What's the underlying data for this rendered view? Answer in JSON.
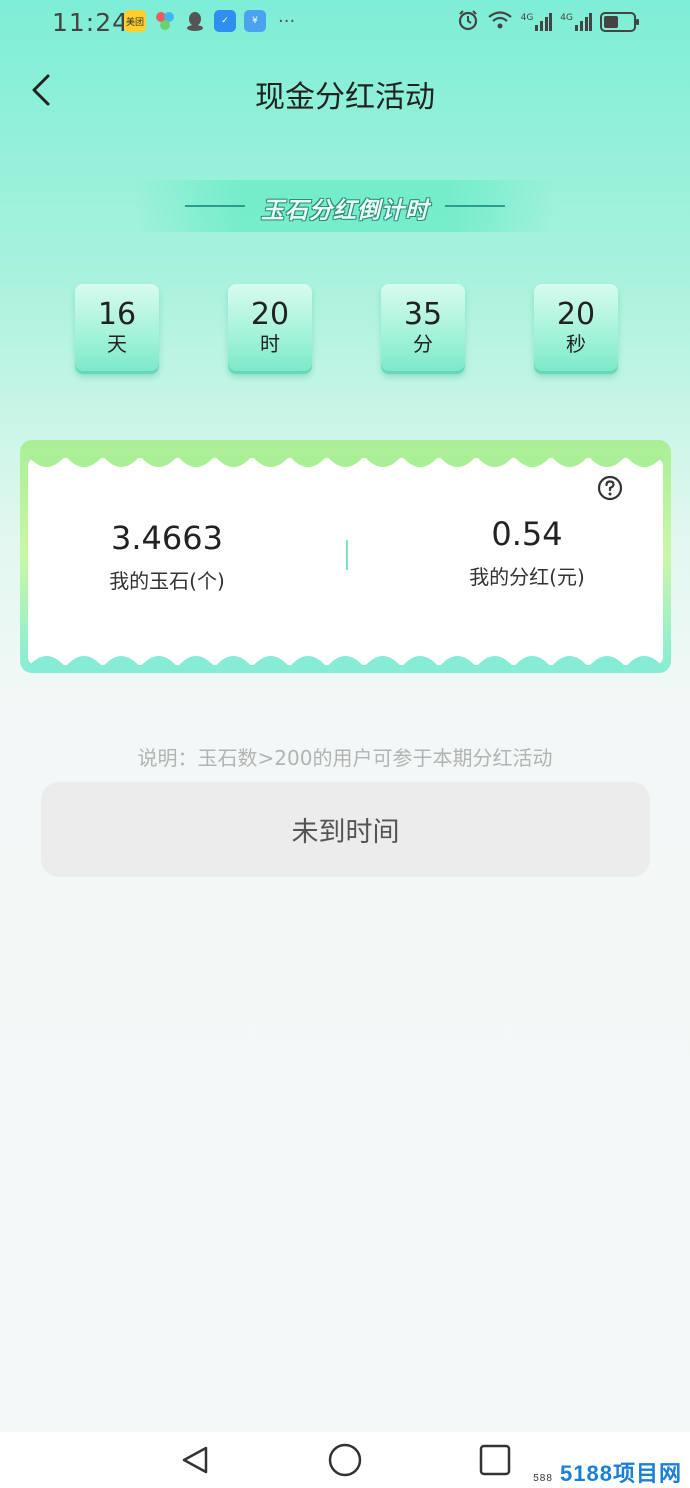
{
  "status_bar": {
    "time": "11:24",
    "apps": [
      "美团",
      "✓",
      "✓",
      "¥"
    ],
    "more": "···",
    "signal1": "4G",
    "signal2": "4G",
    "battery_level": 0.5
  },
  "header": {
    "title": "现金分红活动",
    "back_icon": "chevron-left-icon"
  },
  "banner": {
    "text": "玉石分红倒计时"
  },
  "countdown": [
    {
      "value": "16",
      "unit": "天"
    },
    {
      "value": "20",
      "unit": "时"
    },
    {
      "value": "35",
      "unit": "分"
    },
    {
      "value": "20",
      "unit": "秒"
    }
  ],
  "stats": {
    "jade_value": "3.4663",
    "jade_label": "我的玉石(个)",
    "dividend_value": "0.54",
    "dividend_label": "我的分红(元)",
    "help_icon": "question-circle-icon"
  },
  "note": "说明：玉石数>200的用户可参于本期分红活动",
  "action_button": "未到时间",
  "watermark": {
    "small": "588",
    "text": "5188项目网"
  },
  "colors": {
    "accent": "#7eeed6",
    "card_border_top": "#a9ef96",
    "card_border_bottom": "#86ecd6",
    "button_bg": "#ececec"
  }
}
